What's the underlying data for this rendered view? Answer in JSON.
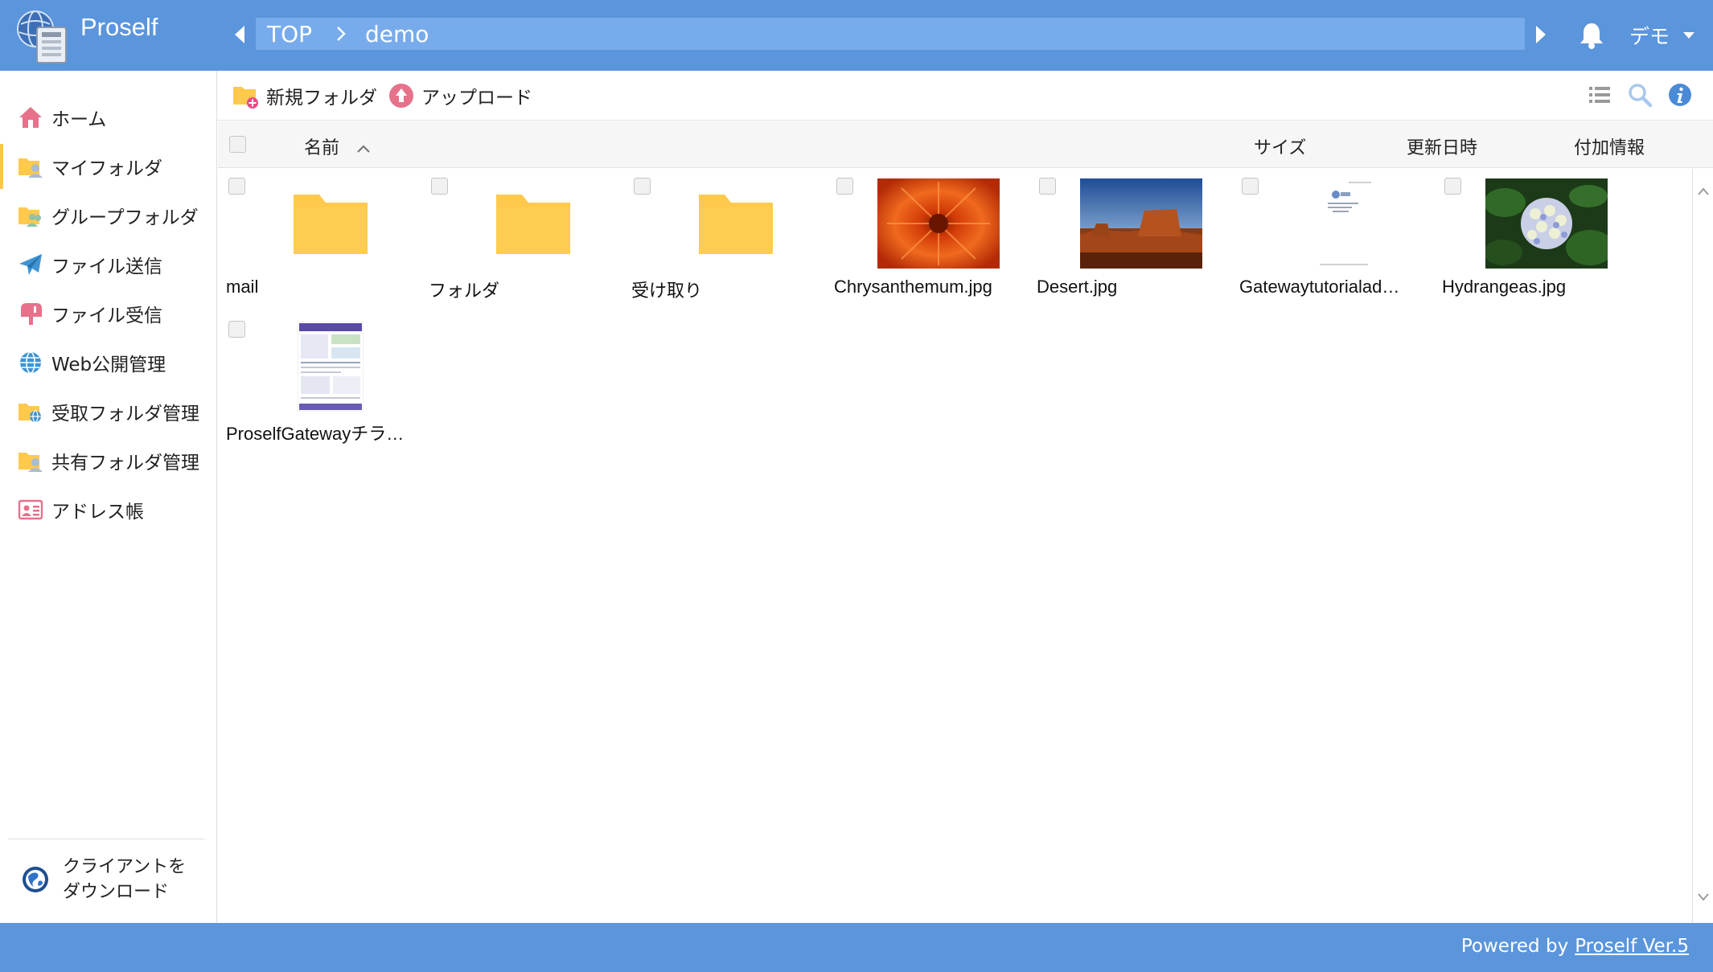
{
  "header": {
    "app_title": "Proself",
    "breadcrumb": [
      "TOP",
      "demo"
    ],
    "user_name": "デモ"
  },
  "sidebar": {
    "items": [
      {
        "label": "ホーム",
        "icon": "home-icon"
      },
      {
        "label": "マイフォルダ",
        "icon": "my-folder-icon"
      },
      {
        "label": "グループフォルダ",
        "icon": "group-folder-icon"
      },
      {
        "label": "ファイル送信",
        "icon": "paper-plane-icon"
      },
      {
        "label": "ファイル受信",
        "icon": "mailbox-icon"
      },
      {
        "label": "Web公開管理",
        "icon": "globe-icon"
      },
      {
        "label": "受取フォルダ管理",
        "icon": "receive-folder-icon"
      },
      {
        "label": "共有フォルダ管理",
        "icon": "shared-folder-icon"
      },
      {
        "label": "アドレス帳",
        "icon": "address-book-icon"
      }
    ],
    "active_index": 1,
    "client_download_line1": "クライアントを",
    "client_download_line2": "ダウンロード"
  },
  "toolbar": {
    "new_folder_label": "新規フォルダ",
    "upload_label": "アップロード"
  },
  "list_header": {
    "name": "名前",
    "size": "サイズ",
    "modified": "更新日時",
    "extra_info": "付加情報"
  },
  "files": [
    {
      "name": "mail",
      "type": "folder"
    },
    {
      "name": "フォルダ",
      "type": "folder"
    },
    {
      "name": "受け取り",
      "type": "folder"
    },
    {
      "name": "Chrysanthemum.jpg",
      "type": "image-chrysanthemum"
    },
    {
      "name": "Desert.jpg",
      "type": "image-desert"
    },
    {
      "name": "Gatewaytutorialad…",
      "type": "document"
    },
    {
      "name": "Hydrangeas.jpg",
      "type": "image-hydrangeas"
    },
    {
      "name": "ProselfGatewayチラ…",
      "type": "flyer"
    }
  ],
  "footer": {
    "powered_by": "Powered by",
    "version_link": "Proself Ver.5"
  },
  "colors": {
    "header_blue": "#5b95db",
    "breadcrumb_blue": "#78abeb",
    "folder_yellow": "#ffc94d",
    "active_accent": "#ffc64a"
  }
}
